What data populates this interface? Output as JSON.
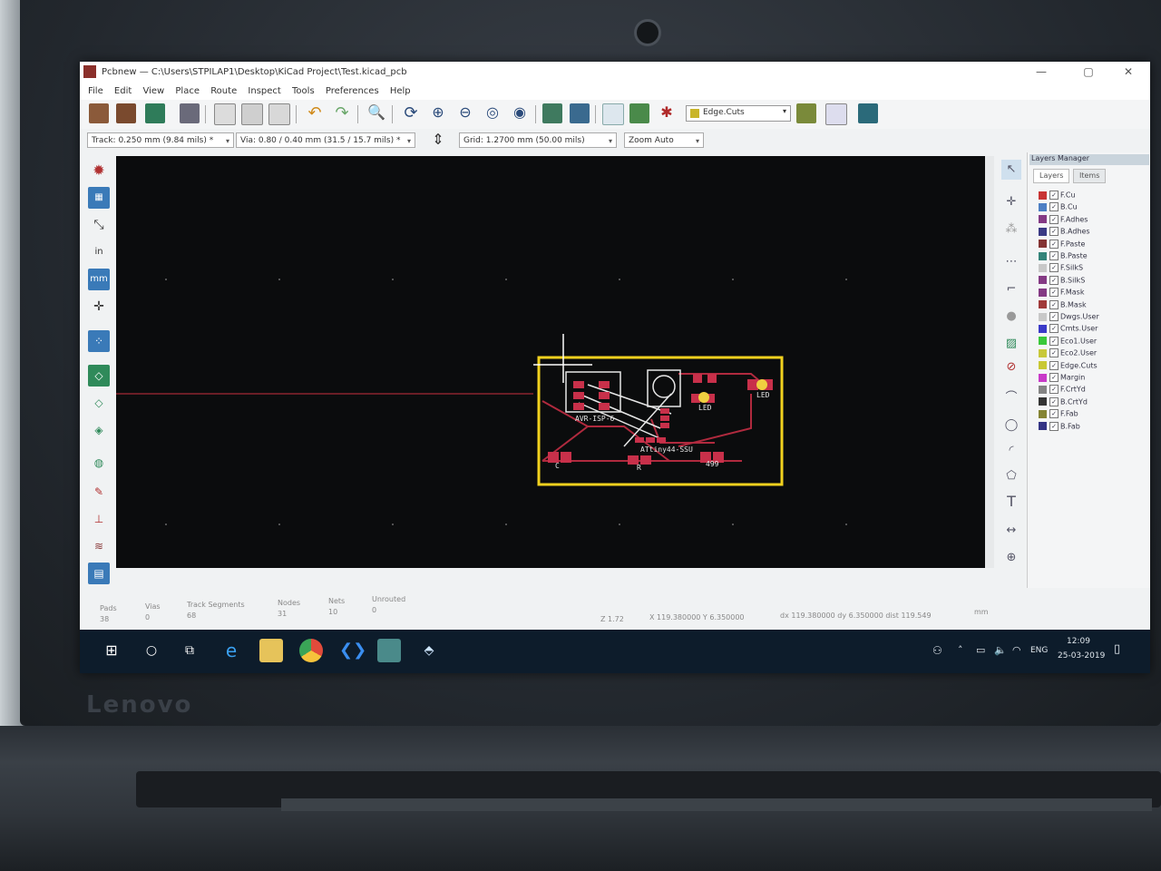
{
  "window": {
    "title": "Pcbnew — C:\\Users\\STPILAP1\\Desktop\\KiCad Project\\Test.kicad_pcb",
    "minimize": "—",
    "maximize": "▢",
    "close": "✕"
  },
  "menu": [
    "File",
    "Edit",
    "View",
    "Place",
    "Route",
    "Inspect",
    "Tools",
    "Preferences",
    "Help"
  ],
  "toolbar": {
    "active_layer": "Edge.Cuts",
    "track": "Track: 0.250 mm (9.84 mils) *",
    "via": "Via: 0.80 / 0.40 mm (31.5 / 15.7 mils) *",
    "grid": "Grid: 1.2700 mm (50.00 mils)",
    "zoom": "Zoom Auto"
  },
  "left_tools": {
    "units_in": "in",
    "units_mm": "mm"
  },
  "layers_manager": {
    "title": "Layers Manager",
    "tabs": [
      "Layers",
      "Items"
    ],
    "layers": [
      {
        "name": "F.Cu",
        "color": "#c83434"
      },
      {
        "name": "B.Cu",
        "color": "#4d7fc4"
      },
      {
        "name": "F.Adhes",
        "color": "#843a84"
      },
      {
        "name": "B.Adhes",
        "color": "#3a3a84"
      },
      {
        "name": "F.Paste",
        "color": "#843434"
      },
      {
        "name": "B.Paste",
        "color": "#34847a"
      },
      {
        "name": "F.SilkS",
        "color": "#c8c8c8"
      },
      {
        "name": "B.SilkS",
        "color": "#843a84"
      },
      {
        "name": "F.Mask",
        "color": "#843a84"
      },
      {
        "name": "B.Mask",
        "color": "#a03a3a"
      },
      {
        "name": "Dwgs.User",
        "color": "#c8c8c8"
      },
      {
        "name": "Cmts.User",
        "color": "#3a3ac8"
      },
      {
        "name": "Eco1.User",
        "color": "#3ac83a"
      },
      {
        "name": "Eco2.User",
        "color": "#c8c83a"
      },
      {
        "name": "Edge.Cuts",
        "color": "#c8c834"
      },
      {
        "name": "Margin",
        "color": "#c83ac8"
      },
      {
        "name": "F.CrtYd",
        "color": "#848484"
      },
      {
        "name": "B.CrtYd",
        "color": "#343434"
      },
      {
        "name": "F.Fab",
        "color": "#848434"
      },
      {
        "name": "B.Fab",
        "color": "#343484"
      }
    ]
  },
  "pcb": {
    "labels": {
      "ic": "ATtiny44-SSU",
      "u1": "AVR-ISP-6",
      "led1": "LED",
      "led2": "LED",
      "r1": "R",
      "c1": "C",
      "r2": "499"
    },
    "colors": {
      "edge": "#f2d21e",
      "copper": "#c8304a",
      "track": "#b02a3e",
      "silk": "#e6e6e6",
      "bg": "#0b0c0d"
    }
  },
  "status": {
    "pads_label": "Pads",
    "pads": "38",
    "vias_label": "Vias",
    "vias": "0",
    "tracks_label": "Track Segments",
    "tracks": "68",
    "nodes_label": "Nodes",
    "nodes": "31",
    "nets_label": "Nets",
    "nets": "10",
    "unrouted_label": "Unrouted",
    "unrouted": "0",
    "zoom": "Z 1.72",
    "xy": "X 119.380000  Y 6.350000",
    "dxdy": "dx 119.380000  dy 6.350000  dist 119.549",
    "units": "mm"
  },
  "taskbar": {
    "lang": "ENG",
    "time": "12:09",
    "date": "25-03-2019"
  },
  "laptop": {
    "brand": "Lenovo"
  }
}
